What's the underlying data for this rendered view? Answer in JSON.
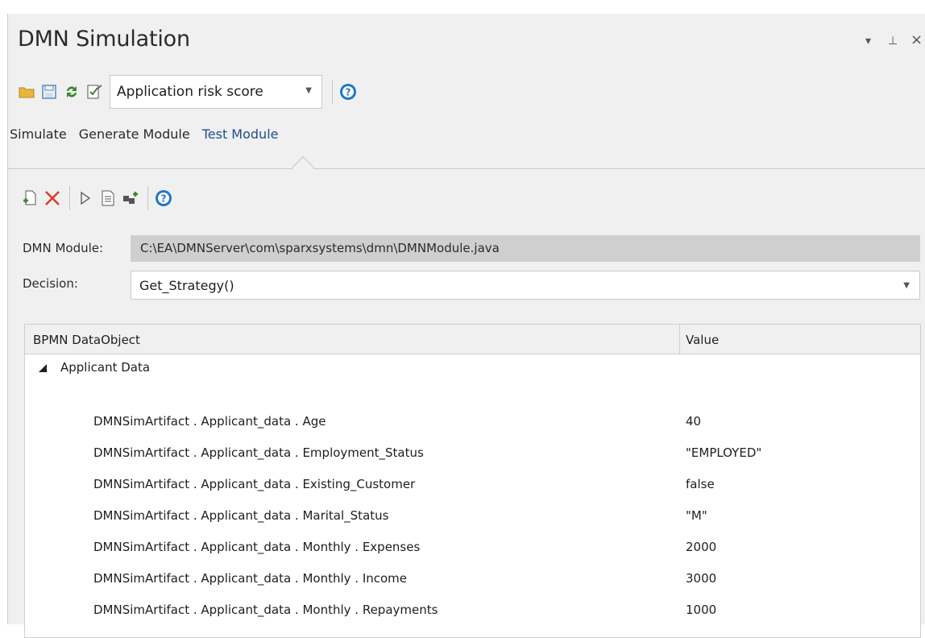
{
  "window": {
    "title": "DMN Simulation",
    "controls": {
      "dropdown": "▾",
      "pin": "⊥",
      "close": "×"
    }
  },
  "toolbar": {
    "selected_model": "Application risk score",
    "icons": [
      "open-folder-icon",
      "save-icon",
      "refresh-icon",
      "edit-check-icon",
      "help-icon"
    ]
  },
  "tabs": [
    {
      "label": "Simulate",
      "active": false
    },
    {
      "label": "Generate Module",
      "active": false
    },
    {
      "label": "Test Module",
      "active": true
    }
  ],
  "subtoolbar": {
    "icons": [
      "new-test-icon",
      "delete-icon",
      "run-icon",
      "document-icon",
      "add-component-icon",
      "help-icon"
    ]
  },
  "form": {
    "module_label": "DMN Module:",
    "module_path": "C:\\EA\\DMNServer\\com\\sparxsystems\\dmn\\DMNModule.java",
    "decision_label": "Decision:",
    "decision_value": "Get_Strategy()"
  },
  "grid": {
    "col1": "BPMN DataObject",
    "col2": "Value",
    "group": "Applicant Data",
    "rows": [
      {
        "name": "DMNSimArtifact . Applicant_data . Age",
        "value": "40"
      },
      {
        "name": "DMNSimArtifact . Applicant_data . Employment_Status",
        "value": "\"EMPLOYED\""
      },
      {
        "name": "DMNSimArtifact . Applicant_data . Existing_Customer",
        "value": "false"
      },
      {
        "name": "DMNSimArtifact . Applicant_data . Marital_Status",
        "value": "\"M\""
      },
      {
        "name": "DMNSimArtifact . Applicant_data . Monthly . Expenses",
        "value": "2000"
      },
      {
        "name": "DMNSimArtifact . Applicant_data . Monthly . Income",
        "value": "3000"
      },
      {
        "name": "DMNSimArtifact . Applicant_data . Monthly . Repayments",
        "value": "1000"
      }
    ]
  },
  "colors": {
    "accent": "#1d4e8f",
    "help_blue": "#1f78c8",
    "delete_red": "#e0392b",
    "refresh_green": "#3a8a2c",
    "folder_yellow": "#e8b63a"
  }
}
